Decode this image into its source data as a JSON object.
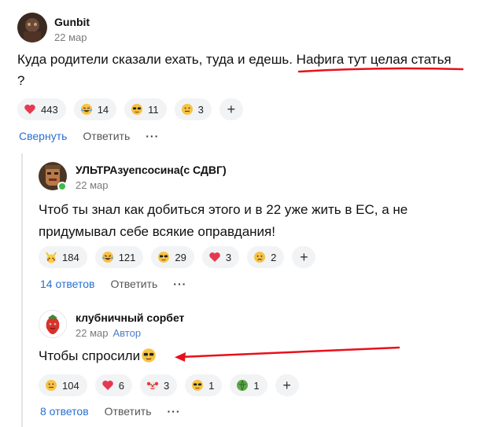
{
  "comment": {
    "author": "Gunbit",
    "date": "22 мар",
    "text_before": "Куда родители сказали ехать, туда и едешь. ",
    "text_highlight": "Нафига тут целая статья",
    "text_after": "?",
    "reactions": [
      {
        "icon": "heart-icon",
        "count": "443"
      },
      {
        "icon": "laugh-tears-icon",
        "count": "14"
      },
      {
        "icon": "sunglasses-icon",
        "count": "11"
      },
      {
        "icon": "neutral-face-icon",
        "count": "3"
      }
    ],
    "collapse_label": "Свернуть",
    "reply_label": "Ответить"
  },
  "reply1": {
    "author": "УЛЬТРАзуепсосина(с СДВГ)",
    "date": "22 мар",
    "text": "Чтоб ты знал как добиться этого и в 22 уже жить в ЕС, а не придумывал себе всякие оправдания!",
    "reactions": [
      {
        "icon": "pikachu-icon",
        "count": "184"
      },
      {
        "icon": "laugh-tears-icon",
        "count": "121"
      },
      {
        "icon": "sunglasses-icon",
        "count": "29"
      },
      {
        "icon": "heart-icon",
        "count": "3"
      },
      {
        "icon": "crying-face-icon",
        "count": "2"
      }
    ],
    "replies_label": "14 ответов",
    "reply_label": "Ответить"
  },
  "reply2": {
    "author": "клубничный сорбет",
    "date": "22 мар",
    "badge": "Автор",
    "text": "Чтобы спросили",
    "reactions": [
      {
        "icon": "neutral-face-icon",
        "count": "104"
      },
      {
        "icon": "heart-icon",
        "count": "6"
      },
      {
        "icon": "clown-icon",
        "count": "3"
      },
      {
        "icon": "sunglasses-icon",
        "count": "1"
      },
      {
        "icon": "cabbage-icon",
        "count": "1"
      }
    ],
    "replies_label": "8 ответов",
    "reply_label": "Ответить"
  },
  "colors": {
    "link": "#2970d1",
    "annotation": "#e8101a",
    "pill_bg": "#f2f3f5"
  }
}
